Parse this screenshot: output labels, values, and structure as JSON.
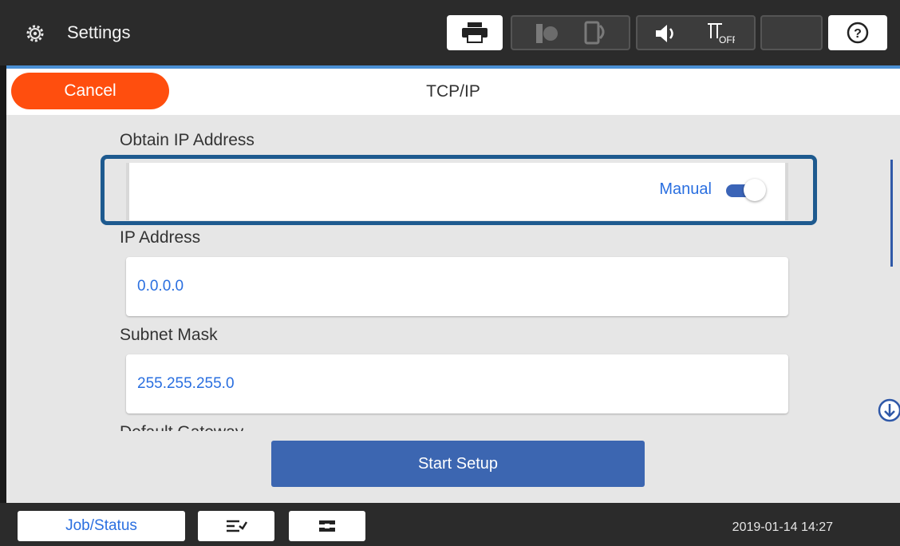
{
  "topbar": {
    "title": "Settings",
    "help_glyph": "?"
  },
  "header": {
    "cancel_label": "Cancel",
    "page_title": "TCP/IP"
  },
  "main": {
    "obtain_label": "Obtain IP Address",
    "obtain_value": "Manual",
    "ip_label": "IP Address",
    "ip_value": "0.0.0.0",
    "subnet_label": "Subnet Mask",
    "subnet_value": "255.255.255.0",
    "gateway_label": "Default Gateway",
    "start_label": "Start Setup"
  },
  "bottombar": {
    "job_label": "Job/Status",
    "datetime": "2019-01-14 14:27"
  },
  "colors": {
    "accent": "#3c66b1",
    "cancel": "#ff4e0e",
    "link": "#2a6fe0"
  },
  "icons": [
    "gear-icon",
    "printer-icon",
    "ink-icon",
    "wifi-direct-icon",
    "sound-icon",
    "eco-off-icon",
    "sleep-icon",
    "help-icon",
    "arrow-down-icon",
    "stop-icon",
    "tray-icon"
  ]
}
